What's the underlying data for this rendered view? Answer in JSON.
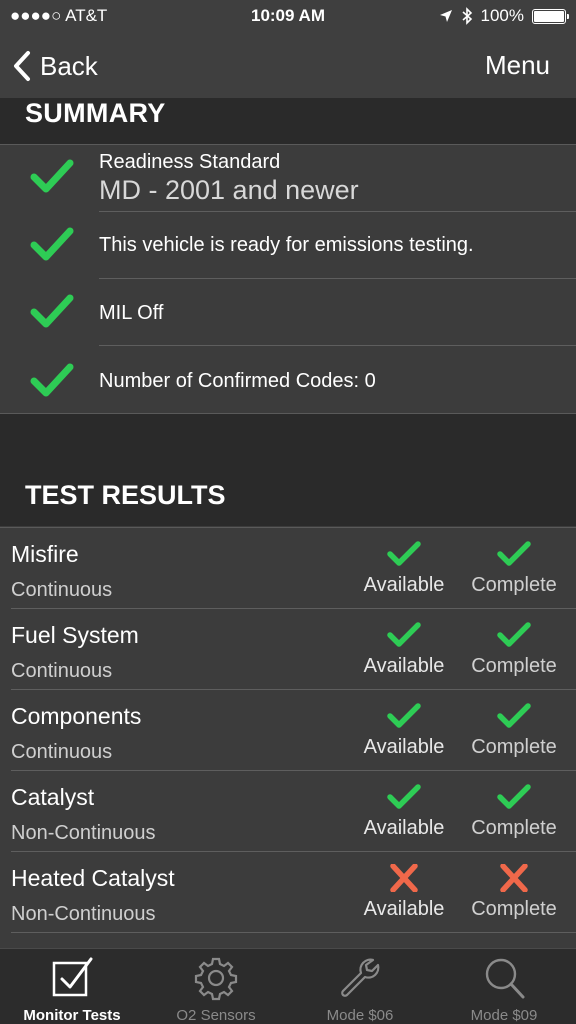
{
  "status_bar": {
    "carrier": "●●●●○ AT&T",
    "time": "10:09 AM",
    "battery": "100%"
  },
  "nav": {
    "back_label": "Back",
    "menu_label": "Menu"
  },
  "summary": {
    "title": "SUMMARY",
    "rows": [
      {
        "label": "Readiness Standard",
        "value": "MD - 2001 and newer",
        "status": "check"
      },
      {
        "label": "This vehicle is ready for emissions testing.",
        "status": "check"
      },
      {
        "label": "MIL Off",
        "status": "check"
      },
      {
        "label": "Number of Confirmed Codes: 0",
        "status": "check"
      }
    ]
  },
  "test_results": {
    "title": "TEST RESULTS",
    "available_label": "Available",
    "complete_label": "Complete",
    "rows": [
      {
        "name": "Misfire",
        "type": "Continuous",
        "available": "check",
        "complete": "check"
      },
      {
        "name": "Fuel System",
        "type": "Continuous",
        "available": "check",
        "complete": "check"
      },
      {
        "name": "Components",
        "type": "Continuous",
        "available": "check",
        "complete": "check"
      },
      {
        "name": "Catalyst",
        "type": "Non-Continuous",
        "available": "check",
        "complete": "check"
      },
      {
        "name": "Heated Catalyst",
        "type": "Non-Continuous",
        "available": "cross",
        "complete": "cross"
      }
    ]
  },
  "tabs": [
    {
      "label": "Monitor Tests",
      "icon": "checkbox-icon",
      "active": true
    },
    {
      "label": "O2 Sensors",
      "icon": "gear-icon",
      "active": false
    },
    {
      "label": "Mode $06",
      "icon": "wrench-icon",
      "active": false
    },
    {
      "label": "Mode $09",
      "icon": "magnifier-icon",
      "active": false
    }
  ],
  "colors": {
    "check": "#2ecc55",
    "cross": "#f0684a",
    "background": "#3c3c3c",
    "header": "#2a2a2a"
  }
}
